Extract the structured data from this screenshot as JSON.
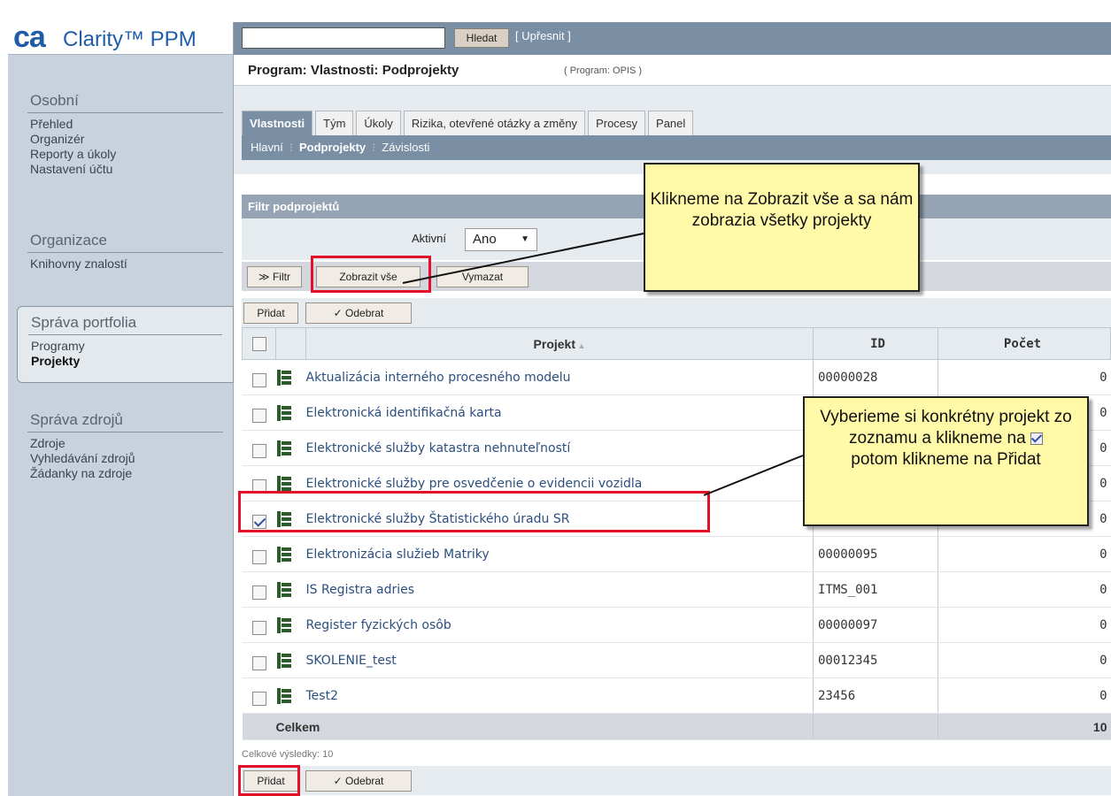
{
  "app": {
    "logo_ca": "ca",
    "logo_name": "Clarity™ PPM",
    "search_placeholder": "",
    "search_button": "Hledat",
    "refine_link": "[ Upřesnit ]"
  },
  "sidebar": {
    "group1": {
      "heading": "Osobní",
      "items": [
        "Přehled",
        "Organizér",
        "Reporty a úkoly",
        "Nastavení účtu"
      ]
    },
    "group2": {
      "heading": "Organizace",
      "items": [
        "Knihovny znalostí"
      ]
    },
    "group3": {
      "heading": "Správa portfolia",
      "items": [
        "Programy",
        "Projekty"
      ]
    },
    "group4": {
      "heading": "Správa zdrojů",
      "items": [
        "Zdroje",
        "Vyhledávání zdrojů",
        "Žádanky na zdroje"
      ]
    }
  },
  "header": {
    "title": "Program: Vlastnosti: Podprojekty",
    "subtitle": "( Program: OPIS )"
  },
  "tabs": [
    "Vlastnosti",
    "Tým",
    "Úkoly",
    "Rizika, otevřené otázky a změny",
    "Procesy",
    "Panel"
  ],
  "subnav": {
    "items": [
      "Hlavní",
      "Podprojekty",
      "Závislosti"
    ]
  },
  "filter": {
    "heading": "Filtr podprojektů",
    "field_label": "Aktivní",
    "field_value": "Ano",
    "filter_button": "≫ Filtr",
    "show_all_button": "Zobrazit vše",
    "clear_button": "Vymazat"
  },
  "actions": {
    "add": "Přidat",
    "remove": "Odebrat"
  },
  "table": {
    "columns": {
      "project": "Projekt",
      "id": "ID",
      "count": "Počet"
    },
    "rows": [
      {
        "name": "Aktualizácia interného procesného modelu",
        "id": "00000028",
        "count": "0",
        "checked": false
      },
      {
        "name": "Elektronická identifikačná karta",
        "id": "",
        "count": "0",
        "checked": false
      },
      {
        "name": "Elektronické služby katastra nehnuteľností",
        "id": "",
        "count": "0",
        "checked": false
      },
      {
        "name": "Elektronické služby pre osvedčenie o evidencii vozidla",
        "id": "",
        "count": "0",
        "checked": false
      },
      {
        "name": "Elektronické služby Štatistického úradu SR",
        "id": "",
        "count": "0",
        "checked": true
      },
      {
        "name": "Elektronizácia služieb Matriky",
        "id": "00000095",
        "count": "0",
        "checked": false
      },
      {
        "name": "IS Registra adries",
        "id": "ITMS_001",
        "count": "0",
        "checked": false
      },
      {
        "name": "Register fyzických osôb",
        "id": "00000097",
        "count": "0",
        "checked": false
      },
      {
        "name": "SKOLENIE_test",
        "id": "00012345",
        "count": "0",
        "checked": false
      },
      {
        "name": "Test2",
        "id": "23456",
        "count": "0",
        "checked": false
      }
    ],
    "total_label": "Celkem",
    "total_value": "10",
    "results_text": "Celkové výsledky: 10"
  },
  "callouts": {
    "top": "Klikneme na Zobrazit vše a sa nám zobrazia všetky projekty",
    "right_line1": "Vyberieme si konkrétny projekt zo zoznamu a klikneme na",
    "right_line2": "potom klikneme na Přidat"
  },
  "colors": {
    "nav_blue": "#7a8ea4",
    "link": "#2a4f80",
    "highlight_red": "#e4102a",
    "callout_yellow": "#fff9a8"
  }
}
